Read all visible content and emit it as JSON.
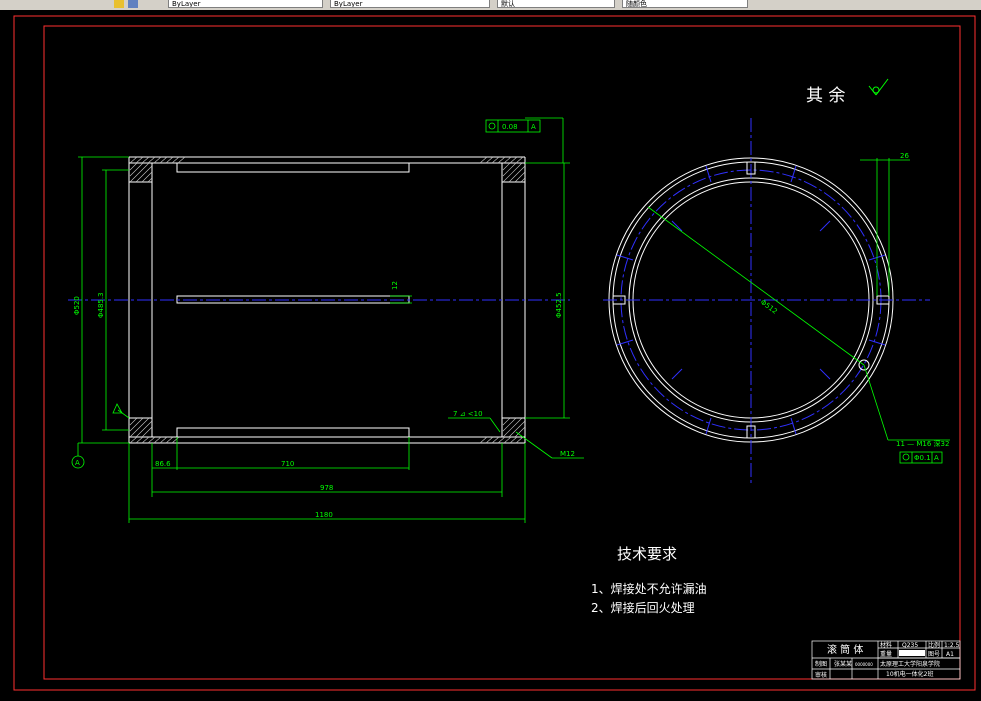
{
  "toolbar": {
    "layer_field": "ByLayer",
    "linetype_field": "ByLayer",
    "lineweight_field": "默认",
    "plotstyle_field": "随颜色"
  },
  "drawing": {
    "roughness_note": "其 余",
    "flatness_tol": "0.08",
    "flatness_datum": "A",
    "datum_label": "A",
    "dim_outer_dia_left": "Φ520",
    "dim_inner_dia_left": "Φ485.3",
    "dim_right_dia": "Φ452.5",
    "dim_slot_width": "12",
    "dim_86": "86.6",
    "dim_710": "710",
    "dim_978": "978",
    "dim_1180": "1180",
    "weld_note": "7 ⊿ <10",
    "thread_note_left": "M12",
    "dim_26": "26",
    "dim_circle_dia": "Φ512",
    "hole_note": "11 — M16 深32",
    "position_tol": "Φ0.1",
    "position_datum": "A"
  },
  "requirements": {
    "title": "技术要求",
    "items": [
      "1、焊接处不允许漏油",
      "2、焊接后回火处理"
    ]
  },
  "title_block": {
    "part_name": "滚 筒 体",
    "material_label": "材料",
    "material": "Q235",
    "scale_label": "比例",
    "scale": "1:2.5",
    "weight_label": "重量",
    "sheet_label": "图号",
    "sheet": "A1",
    "designer_label": "制图",
    "designer": "张某某",
    "id": "0000000",
    "reviewer_label": "审核",
    "school": "太原理工大学阳泉学院",
    "class": "10机电一体化2班"
  },
  "colors": {
    "frame": "#ff3030",
    "dim": "#00ff00",
    "center": "#3030ff",
    "line": "#ffffff"
  }
}
